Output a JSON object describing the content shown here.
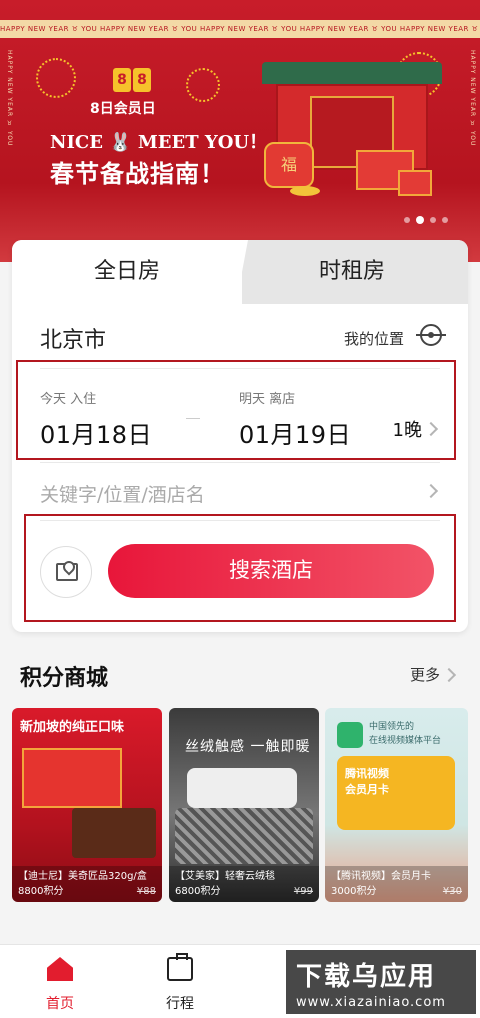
{
  "banner": {
    "ribbon_text": "HAPPY NEW YEAR ♉ YOU     HAPPY NEW YEAR ♉ YOU     HAPPY NEW YEAR ♉ YOU     HAPPY NEW YEAR ♉ YOU     HAPPY NEW YEAR ♉ YOU",
    "side_text": "HAPPY NEW YEAR ♉ YOU",
    "logo": "8",
    "subtitle": "8日会员日",
    "tagline": "NICE 🐰 MEET YOU！",
    "title": "春节备战指南！",
    "lantern_char": "福",
    "slide_count": 4,
    "active_slide": 1
  },
  "booking": {
    "tabs": [
      "全日房",
      "时租房"
    ],
    "active_tab": 0,
    "city": "北京市",
    "my_location": "我的位置",
    "checkin_label": "今天 入住",
    "checkin_date": "01月18日",
    "checkout_label": "明天 离店",
    "checkout_date": "01月19日",
    "nights": "1晚",
    "keyword_placeholder": "关键字/位置/酒店名",
    "search_button": "搜索酒店"
  },
  "mall": {
    "title": "积分商城",
    "more": "更多",
    "items": [
      {
        "header": "新加坡的纯正口味",
        "name": "【迪士尼】美奇匠品320g/盒",
        "points": "8800积分",
        "old_price": "¥88"
      },
      {
        "header": "丝绒触感  一触即暖",
        "name": "【艾美家】轻奢云绒毯",
        "points": "6800积分",
        "old_price": "¥99"
      },
      {
        "header": "中国领先的\n在线视频媒体平台",
        "card_text": "腾讯视频\n会员月卡",
        "name": "【腾讯视频】会员月卡",
        "points": "3000积分",
        "old_price": "¥30"
      }
    ]
  },
  "nav": {
    "items": [
      "首页",
      "行程"
    ],
    "active": 0,
    "active_color": "#e21d2e"
  },
  "watermark": {
    "line1": "下载乌应用",
    "line2": "www.xiazainiao.com"
  },
  "colors": {
    "brand_red": "#c81d2a",
    "button_start": "#e8163a",
    "button_end": "#f25367",
    "highlight_border": "#b3171f"
  }
}
